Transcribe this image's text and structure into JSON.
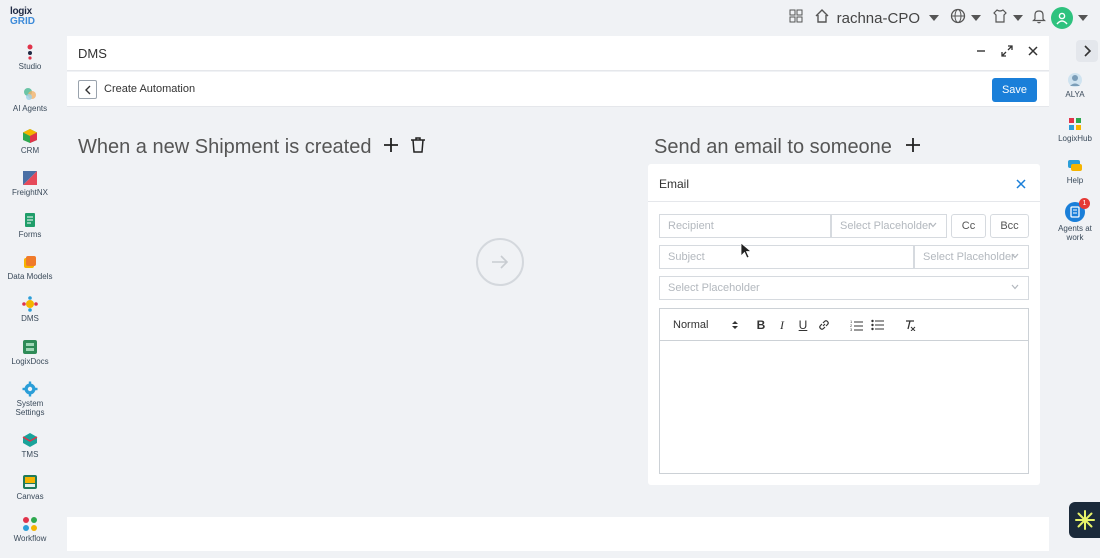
{
  "brand": {
    "line1": "logix",
    "line2": "GRID",
    "accent": "#3d8bd9"
  },
  "topbar": {
    "user": "rachna-CPO"
  },
  "sidebar": {
    "items": [
      {
        "label": "Studio",
        "color": "#e0334a"
      },
      {
        "label": "AI Agents",
        "color": "#6bc4a6"
      },
      {
        "label": "CRM",
        "color": "#2ea84f"
      },
      {
        "label": "FreightNX",
        "color": "#e64a5a"
      },
      {
        "label": "Forms",
        "color": "#1f9e6a"
      },
      {
        "label": "Data Models",
        "color": "#f07a2a"
      },
      {
        "label": "DMS",
        "color": "#f5b400"
      },
      {
        "label": "LogixDocs",
        "color": "#2e8b57"
      },
      {
        "label": "System Settings",
        "color": "#2b9ed8"
      },
      {
        "label": "TMS",
        "color": "#1aa39a"
      },
      {
        "label": "Canvas",
        "color": "#1f7a5a"
      },
      {
        "label": "Workflow",
        "color": "#e0334a"
      }
    ]
  },
  "right_sidebar": {
    "items": [
      {
        "label": "ALYA"
      },
      {
        "label": "LogixHub"
      },
      {
        "label": "Help"
      },
      {
        "label": "Agents at work",
        "badge": "1"
      }
    ]
  },
  "window": {
    "title": "DMS"
  },
  "subbar": {
    "title": "Create Automation",
    "save_label": "Save"
  },
  "workflow": {
    "trigger_text": "When a new Shipment is created",
    "action_text": "Send an email to someone"
  },
  "email": {
    "title": "Email",
    "recipient_placeholder": "Recipient",
    "placeholder_select_1": "Select Placeholder",
    "cc_label": "Cc",
    "bcc_label": "Bcc",
    "subject_placeholder": "Subject",
    "placeholder_select_2": "Select Placeholder",
    "placeholder_select_3": "Select Placeholder",
    "format_select": "Normal"
  },
  "colors": {
    "primary": "#1a7fd9",
    "avatar": "#2ec27e"
  }
}
